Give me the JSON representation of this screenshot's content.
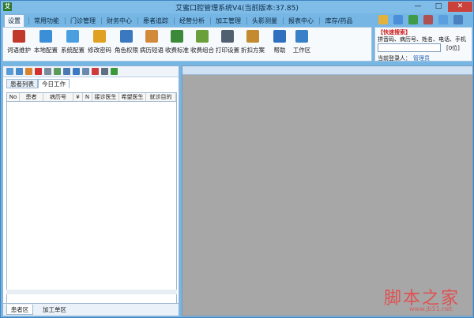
{
  "window": {
    "title": "艾蜜口腔管理系统V4(当前版本:37.85)",
    "controls": {
      "minimize": "—",
      "maximize": "□",
      "close": "✕"
    }
  },
  "menu": {
    "tabs": [
      "设置",
      "常用功能",
      "门诊管理",
      "财务中心",
      "患者追踪",
      "经营分析",
      "加工管理",
      "头影测量",
      "报表中心",
      "库存/药品"
    ],
    "active_index": 0
  },
  "toolbar": {
    "items": [
      {
        "label": "词语维护",
        "icon": "book-edit-icon",
        "color": "#c0392b"
      },
      {
        "label": "本地配置",
        "icon": "local-config-icon",
        "color": "#3b8fd9"
      },
      {
        "label": "系统配置",
        "icon": "system-config-icon",
        "color": "#4a9fe0"
      },
      {
        "label": "修改密码",
        "icon": "key-icon",
        "color": "#e0a020"
      },
      {
        "label": "角色权限",
        "icon": "role-permission-icon",
        "color": "#3a78c0"
      },
      {
        "label": "病历短语",
        "icon": "record-phrase-icon",
        "color": "#d28a3a"
      },
      {
        "label": "收费标准",
        "icon": "fee-standard-icon",
        "color": "#3a8a3a"
      },
      {
        "label": "收费组合",
        "icon": "fee-combo-icon",
        "color": "#6a9f3a"
      },
      {
        "label": "打印设置",
        "icon": "printer-icon",
        "color": "#506070"
      },
      {
        "label": "折扣方案",
        "icon": "discount-icon",
        "color": "#c48a30"
      },
      {
        "label": "帮助",
        "icon": "help-icon",
        "color": "#2f6fc0"
      },
      {
        "label": "工作区",
        "icon": "workspace-icon",
        "color": "#3a80c8"
      }
    ]
  },
  "quick_search": {
    "title": "【快速搜索】",
    "hint": "拼音码、病历号、姓名、电话、手机",
    "input_value": "",
    "count": "[0位]",
    "login_label": "当前登录人：",
    "login_user": "管理员"
  },
  "quick_icons": [
    {
      "icon": "search-icon",
      "color": "#e3b23c"
    },
    {
      "icon": "user-icon",
      "color": "#4a8fd8"
    },
    {
      "icon": "group-icon",
      "color": "#3f9a4a"
    },
    {
      "icon": "chart-icon",
      "color": "#b05050"
    },
    {
      "icon": "message-icon",
      "color": "#5aa0e0"
    },
    {
      "icon": "info-icon",
      "color": "#4a7fc0"
    }
  ],
  "left_panel": {
    "toolbar_icons": [
      {
        "icon": "new-icon",
        "color": "#5b9bd5"
      },
      {
        "icon": "open-icon",
        "color": "#4a8ac8"
      },
      {
        "icon": "edit-icon",
        "color": "#d9822b"
      },
      {
        "icon": "delete-icon",
        "color": "#d03030"
      },
      {
        "icon": "copy-icon",
        "color": "#7a8a9a"
      },
      {
        "icon": "import-icon",
        "color": "#5a9a5a"
      },
      {
        "icon": "export-icon",
        "color": "#4a7ab0"
      },
      {
        "icon": "transfer-icon",
        "color": "#3a7ac0"
      },
      {
        "icon": "link-icon",
        "color": "#6a8ab0"
      },
      {
        "icon": "check-icon",
        "color": "#d03a3a"
      },
      {
        "icon": "print-icon",
        "color": "#607080"
      },
      {
        "icon": "exit-icon",
        "color": "#3a9a3a"
      }
    ],
    "tabs": [
      "患者列表",
      "今日工作"
    ],
    "active_tab": 1,
    "columns": [
      "No",
      "患者",
      "病历号",
      "¥",
      "N",
      "接诊医生",
      "希望医生",
      "就诊目的"
    ],
    "bottom_tabs": [
      "患者区",
      "加工单区"
    ],
    "active_bottom_tab": 0
  },
  "watermark": {
    "logo": "脚本之家",
    "url": "www.jb51.net"
  }
}
